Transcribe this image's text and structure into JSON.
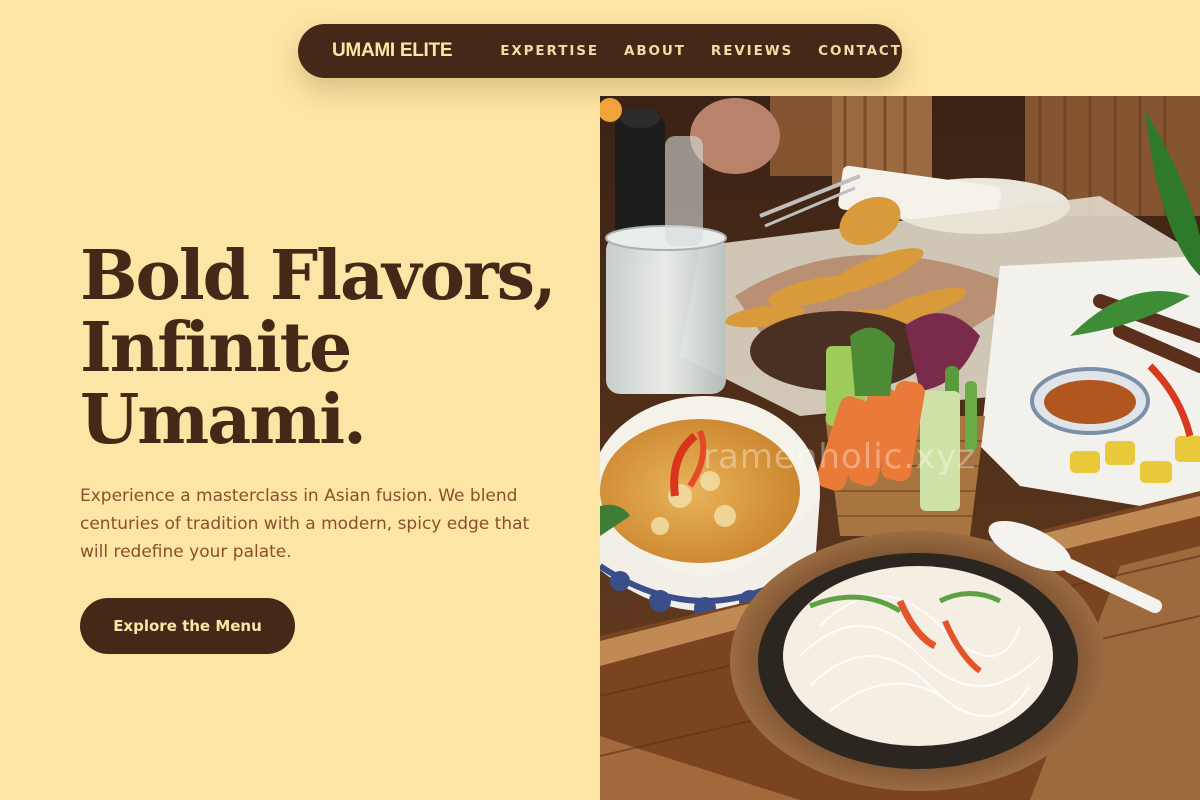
{
  "nav": {
    "brand": "UMAMI ELITE",
    "links": [
      "EXPERTISE",
      "ABOUT",
      "REVIEWS",
      "CONTACT"
    ]
  },
  "hero": {
    "title_lines": [
      "Bold Flavors,",
      "Infinite",
      "Umami."
    ],
    "description": "Experience a masterclass in Asian fusion. We blend centuries of tradition with a modern, spicy edge that will redefine your palate.",
    "cta_label": "Explore the Menu"
  },
  "image": {
    "watermark": "ramenholic.xyz"
  },
  "colors": {
    "background": "#fde5a5",
    "primary": "#452818",
    "text_accent": "#8a4f2b"
  }
}
